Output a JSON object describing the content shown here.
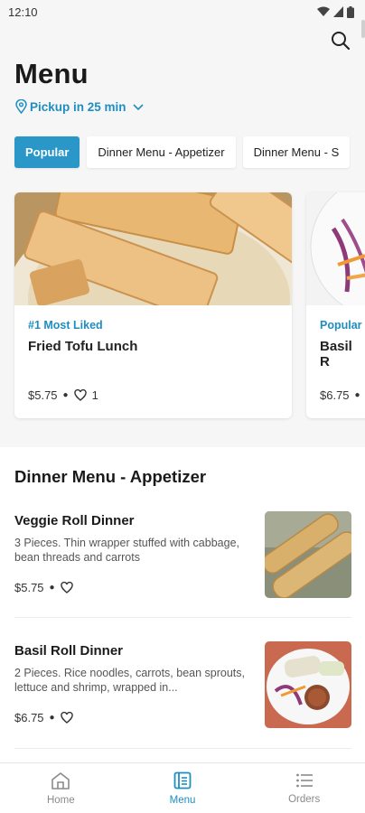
{
  "status": {
    "time": "12:10"
  },
  "header": {
    "title": "Menu",
    "pickup": "Pickup in 25 min"
  },
  "chips": [
    "Popular",
    "Dinner Menu - Appetizer",
    "Dinner Menu - S"
  ],
  "featured": [
    {
      "tag": "#1 Most Liked",
      "title": "Fried Tofu Lunch",
      "price": "$5.75",
      "likes": "1"
    },
    {
      "tag": "Popular",
      "title": "Basil R",
      "price": "$6.75"
    }
  ],
  "section": {
    "title": "Dinner Menu - Appetizer",
    "items": [
      {
        "name": "Veggie Roll Dinner",
        "desc": "3 Pieces. Thin wrapper stuffed with cabbage, bean threads and carrots",
        "price": "$5.75"
      },
      {
        "name": "Basil Roll Dinner",
        "desc": "2 Pieces. Rice noodles, carrots, bean sprouts, lettuce and shrimp, wrapped in...",
        "price": "$6.75"
      }
    ]
  },
  "nav": {
    "home": "Home",
    "menu": "Menu",
    "orders": "Orders"
  },
  "colors": {
    "accent": "#2a97c8",
    "link": "#1e8ec2"
  }
}
